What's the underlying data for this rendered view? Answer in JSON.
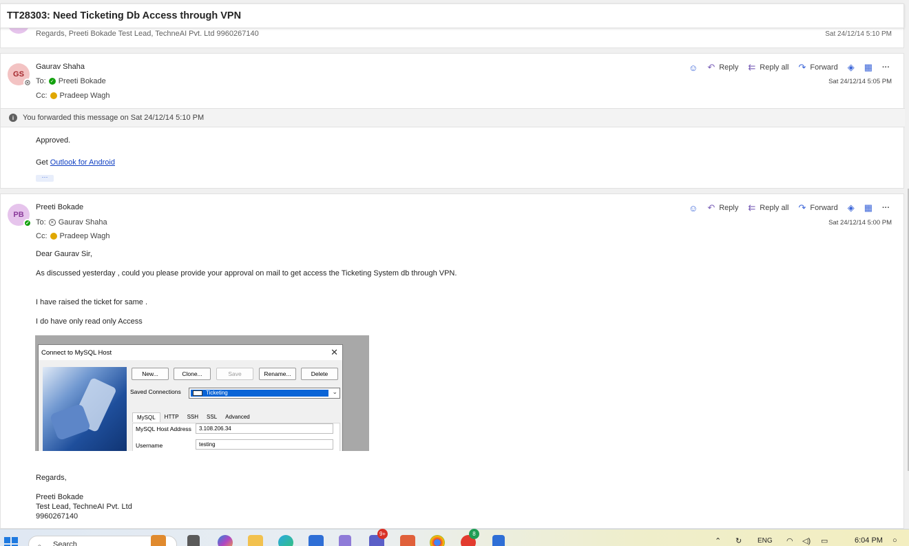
{
  "subject": "TT28303: Need Ticketing Db Access through VPN",
  "collapsed_message": {
    "preview": "Regards, Preeti Bokade Test Lead, TechneAI Pvt. Ltd 9960267140",
    "timestamp": "Sat 24/12/14 5:10 PM"
  },
  "message1": {
    "avatar": "GS",
    "sender": "Gaurav Shaha",
    "to_label": "To:",
    "to": "Preeti Bokade",
    "cc_label": "Cc:",
    "cc": "Pradeep Wagh",
    "timestamp": "Sat 24/12/14 5:05 PM",
    "forwarded_notice": "You forwarded this message on Sat 24/12/14 5:10 PM",
    "body_line": "Approved.",
    "get_prefix": "Get",
    "get_link": "Outlook for Android",
    "ellipsis": "···"
  },
  "message2": {
    "avatar": "PB",
    "sender": "Preeti Bokade",
    "to_label": "To:",
    "to": "Gaurav Shaha",
    "cc_label": "Cc:",
    "cc": "Pradeep Wagh",
    "timestamp": "Sat 24/12/14 5:00 PM",
    "greeting": "Dear Gaurav Sir,",
    "para1": "As discussed yesterday , could you please provide your approval on mail to get access the Ticketing System db through VPN.",
    "para2": "I have raised the ticket for same .",
    "para3": "I do have only read only Access",
    "sign_regards": "Regards,",
    "sign_name": "Preeti Bokade",
    "sign_title": "Test Lead, TechneAI Pvt. Ltd",
    "sign_phone": "9960267140"
  },
  "actions": {
    "reply": "Reply",
    "reply_all": "Reply all",
    "forward": "Forward",
    "more": "···"
  },
  "embedded_dialog": {
    "title": "Connect to MySQL Host",
    "buttons": [
      "New...",
      "Clone...",
      "Save",
      "Rename...",
      "Delete"
    ],
    "saved_connections_label": "Saved Connections",
    "saved_connection_value": "Ticketing",
    "tabs": [
      "MySQL",
      "HTTP",
      "SSH",
      "SSL",
      "Advanced"
    ],
    "host_label": "MySQL Host Address",
    "host_value": "3.108.206.34",
    "username_label": "Username",
    "username_value": "testing"
  },
  "taskbar": {
    "search_placeholder": "Search",
    "language": "ENG",
    "time": "6:04 PM",
    "badge_teams": "9+",
    "badge_other": "8"
  }
}
